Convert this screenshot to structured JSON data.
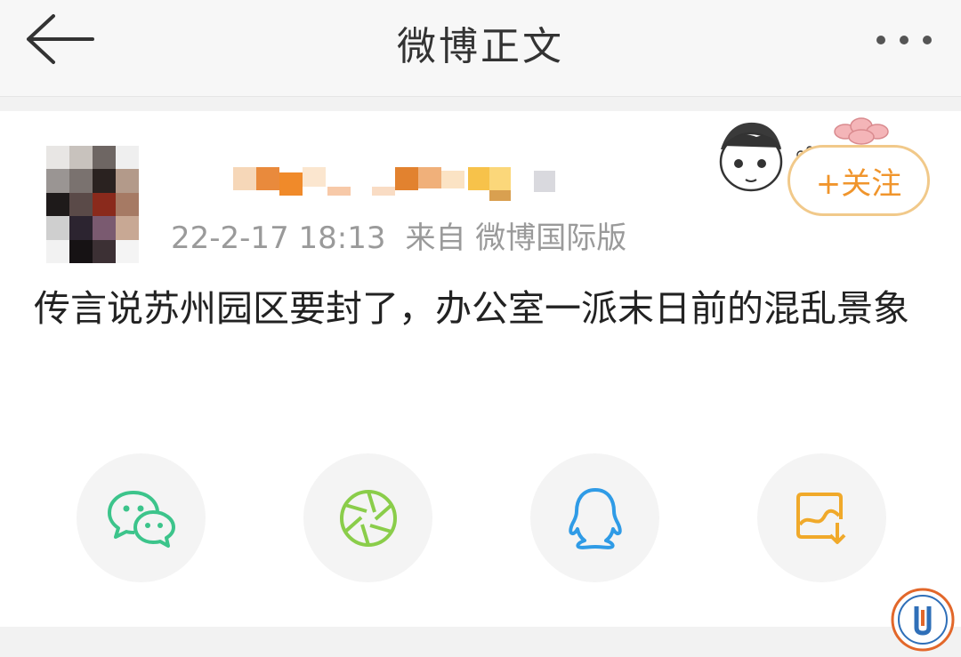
{
  "nav": {
    "title": "微博正文",
    "back_icon": "back-arrow-icon",
    "more_icon": "more-dots-icon"
  },
  "post": {
    "timestamp": "22-2-17 18:13",
    "source": "来自 微博国际版",
    "follow_label": "+关注",
    "text": "传言说苏州园区要封了，办公室一派末日前的混乱景象"
  },
  "share_targets": [
    {
      "icon": "wechat-icon",
      "color": "#3cc48b"
    },
    {
      "icon": "moments-icon",
      "color": "#8acd4a"
    },
    {
      "icon": "qq-icon",
      "color": "#2f9be6"
    },
    {
      "icon": "save-image-icon",
      "color": "#f0a92a"
    }
  ],
  "colors": {
    "accent": "#f0952c",
    "follow_border": "#f1c98a",
    "meta_text": "#9a9a9a"
  }
}
